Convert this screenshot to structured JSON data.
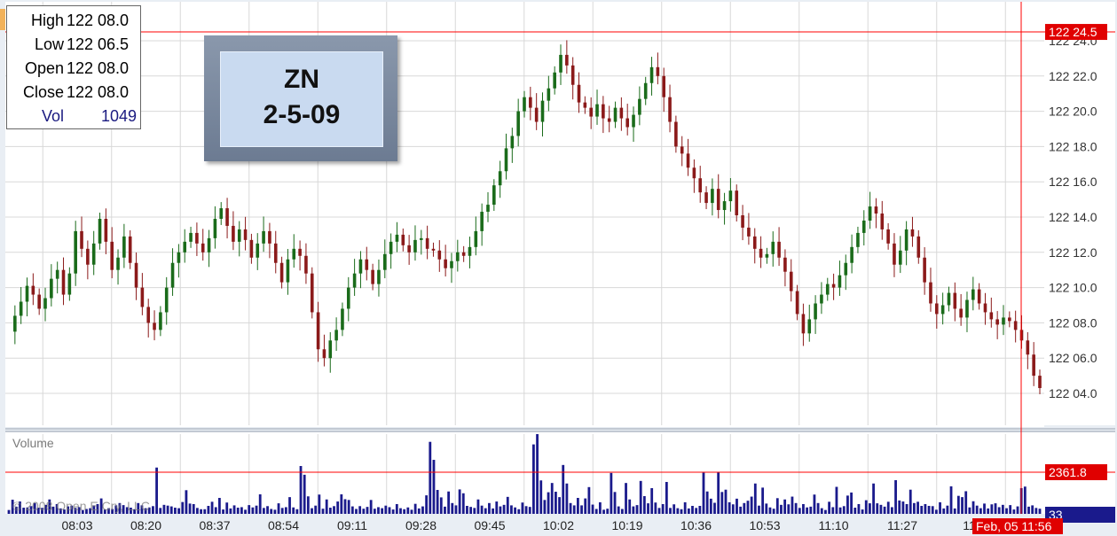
{
  "ohlc_box": {
    "high_label": "High",
    "high_value": "122 08.0",
    "low_label": "Low",
    "low_value": "122 06.5",
    "open_label": "Open",
    "open_value": "122 08.0",
    "close_label": "Close",
    "close_value": "122 08.0",
    "vol_label": "Vol",
    "vol_value": "1049"
  },
  "title_box": {
    "symbol": "ZN",
    "date": "2-5-09"
  },
  "volume_label": "Volume",
  "watermark": "© 2008 Open E Cry, LLC",
  "price_axis_badge": "122 24.5",
  "volume_axis_badge": "2361.8",
  "volume_current_badge": "33",
  "time_badge": "Feb, 05 11:56",
  "colors": {
    "up": "#1a6b1a",
    "down": "#8b1a1a",
    "volume": "#1a1a8c",
    "crosshair": "#ff0000",
    "grid": "#d8d8d8"
  },
  "chart_data": {
    "type": "candlestick",
    "x_tick_labels": [
      "08:03",
      "08:20",
      "08:37",
      "08:54",
      "09:11",
      "09:28",
      "09:45",
      "10:02",
      "10:19",
      "10:36",
      "10:53",
      "11:10",
      "11:27",
      "11:"
    ],
    "y_tick_labels": [
      "122 24.0",
      "122 22.0",
      "122 20.0",
      "122 18.0",
      "122 16.0",
      "122 14.0",
      "122 12.0",
      "122 10.0",
      "122 08.0",
      "122 06.0",
      "122 04.0"
    ],
    "ylim": [
      123.0,
      100.0
    ],
    "crosshair_price": 24.5,
    "volume_reference": 2361.8,
    "volume_max": 3100,
    "y_tick_values": [
      24,
      22,
      20,
      18,
      16,
      14,
      12,
      10,
      8,
      6,
      4
    ],
    "price_path": [
      7.5,
      8.4,
      9.2,
      10.1,
      9.6,
      8.8,
      9.4,
      10.5,
      11.0,
      9.6,
      10.8,
      13.2,
      12.2,
      11.3,
      12.5,
      13.9,
      12.6,
      11.0,
      11.7,
      12.9,
      11.4,
      10.0,
      8.9,
      8.0,
      7.6,
      8.6,
      10.0,
      11.4,
      12.0,
      12.6,
      13.1,
      12.5,
      12.0,
      12.8,
      13.9,
      14.5,
      13.5,
      12.6,
      13.3,
      12.7,
      11.7,
      12.5,
      13.2,
      12.5,
      11.4,
      10.3,
      11.6,
      12.2,
      11.8,
      10.8,
      8.6,
      6.5,
      6.0,
      7.0,
      7.6,
      8.8,
      10.0,
      10.8,
      11.6,
      11.0,
      10.2,
      11.0,
      11.9,
      12.6,
      13.0,
      12.4,
      12.0,
      12.7,
      12.8,
      12.2,
      12.1,
      11.6,
      11.1,
      11.5,
      12.0,
      11.8,
      12.3,
      13.2,
      14.3,
      14.7,
      15.8,
      16.6,
      17.9,
      18.6,
      20.0,
      20.8,
      20.2,
      19.4,
      20.6,
      21.3,
      22.2,
      23.2,
      22.6,
      21.5,
      20.5,
      20.2,
      19.7,
      20.4,
      19.6,
      19.4,
      20.2,
      19.6,
      19.1,
      19.8,
      20.7,
      21.6,
      22.5,
      22.0,
      20.8,
      19.4,
      18.0,
      17.6,
      16.8,
      16.2,
      15.4,
      14.8,
      15.6,
      14.4,
      14.9,
      15.5,
      14.1,
      13.4,
      12.9,
      12.2,
      11.7,
      11.9,
      12.6,
      11.7,
      10.9,
      9.8,
      8.5,
      7.4,
      8.2,
      9.1,
      9.6,
      10.2,
      10.0,
      10.7,
      11.4,
      12.3,
      13.1,
      13.8,
      14.6,
      14.2,
      13.3,
      12.5,
      11.3,
      12.1,
      13.3,
      12.9,
      11.7,
      10.3,
      9.1,
      8.5,
      9.0,
      9.7,
      8.8,
      8.3,
      9.3,
      9.9,
      9.1,
      8.6,
      8.2,
      7.9,
      8.3,
      8.1,
      7.6,
      7.0,
      6.2,
      5.0,
      4.3
    ],
    "volumes": [
      150,
      550,
      280,
      480,
      240,
      250,
      300,
      420,
      240,
      230,
      350,
      560,
      280,
      380,
      210,
      170,
      290,
      320,
      230,
      260,
      150,
      190,
      220,
      330,
      380,
      600,
      170,
      220,
      190,
      330,
      420,
      340,
      260,
      240,
      180,
      420,
      330,
      220,
      250,
      300,
      1800,
      230,
      350,
      320,
      290,
      240,
      220,
      460,
      920,
      400,
      380,
      230,
      180,
      180,
      310,
      470,
      260,
      620,
      170,
      440,
      210,
      330,
      240,
      260,
      160,
      340,
      250,
      320,
      760,
      230,
      300,
      190,
      160,
      410,
      230,
      260,
      650,
      250,
      180,
      1860,
      1520,
      680,
      220,
      320,
      750,
      200,
      560,
      240,
      300,
      480,
      760,
      570,
      540,
      290,
      190,
      300,
      200,
      270,
      540,
      200,
      260,
      220,
      320,
      260,
      170,
      380,
      220,
      180,
      250,
      160,
      390,
      210,
      290,
      720,
      2800,
      2100,
      930,
      640,
      280,
      870,
      420,
      330,
      950,
      800,
      310,
      270,
      230,
      560,
      320,
      220,
      420,
      210,
      480,
      290,
      350,
      660,
      330,
      250,
      180,
      440,
      300,
      270,
      2700,
      3100,
      1300,
      540,
      840,
      1200,
      860,
      650,
      1900,
      1180,
      420,
      330,
      620,
      330,
      600,
      1040,
      360,
      190,
      450,
      160,
      200,
      1590,
      850,
      290,
      190,
      1200,
      560,
      290,
      340,
      1280,
      690,
      410,
      1000,
      440,
      230,
      380,
      1240,
      230,
      370,
      220,
      180,
      450,
      210,
      310,
      230,
      310,
      1600,
      870,
      590,
      430,
      1610,
      850,
      940,
      450,
      370,
      590,
      280,
      420,
      510,
      670,
      1180,
      320,
      1020,
      400,
      250,
      200,
      610,
      350,
      560,
      370,
      670,
      420,
      230,
      380,
      250,
      280,
      750,
      420,
      220,
      150,
      470,
      260,
      1050,
      250,
      300,
      710,
      830,
      240,
      380,
      170,
      530,
      410,
      1180,
      410,
      350,
      280,
      470,
      260,
      1310,
      520,
      480,
      380,
      940,
      420,
      470,
      310,
      380,
      310,
      300,
      160,
      450,
      210,
      320,
      1070,
      210,
      700,
      650,
      880,
      250,
      490,
      320,
      220,
      400,
      210,
      370,
      410,
      260,
      350,
      220,
      340,
      170,
      290,
      1000,
      1060,
      280,
      330,
      230,
      200
    ]
  }
}
